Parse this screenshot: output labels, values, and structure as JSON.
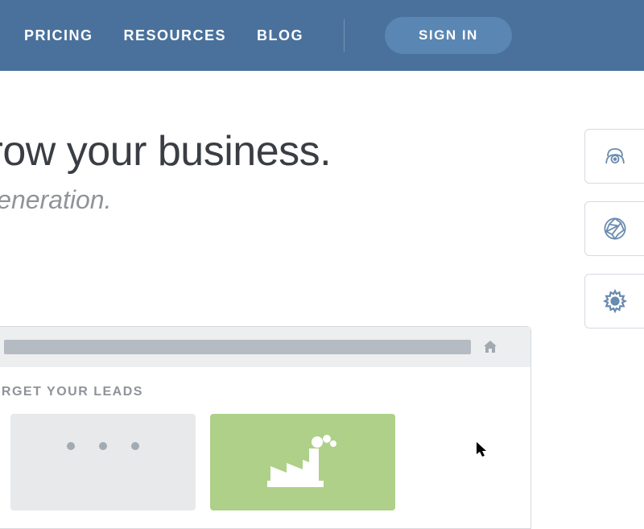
{
  "nav": {
    "pricing": "PRICING",
    "resources": "RESOURCES",
    "blog": "BLOG",
    "signin": "SIGN IN"
  },
  "hero": {
    "title": "nts to grow your business.",
    "subtitle": "out of lead generation."
  },
  "browser": {
    "criteria_label": " CRITERIA TO TARGET YOUR LEADS"
  }
}
